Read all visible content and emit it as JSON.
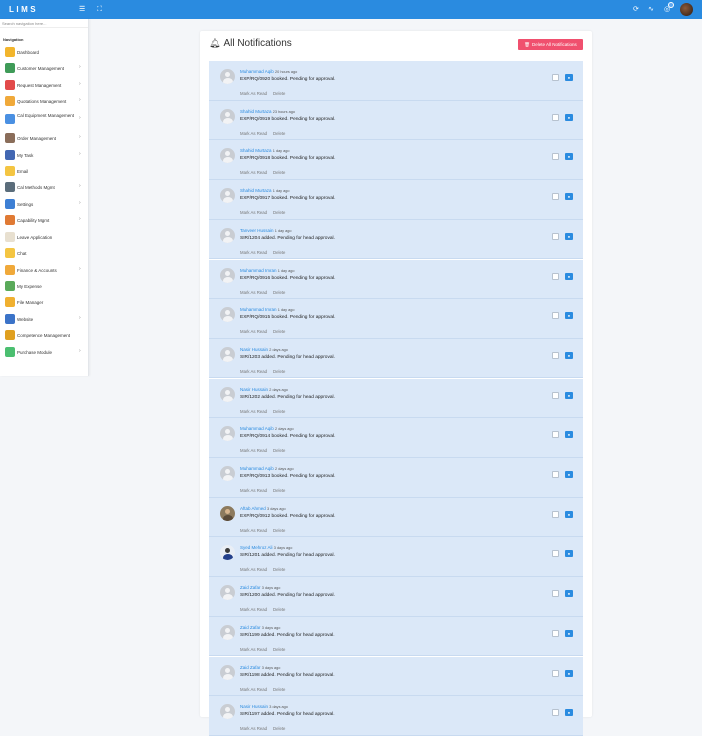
{
  "app": {
    "logo": "LIMS"
  },
  "search": {
    "placeholder": "Search navigation here..."
  },
  "nav_title": "Navigation",
  "nav": [
    {
      "label": "Dashboard",
      "arrow": false,
      "color": "#f2b52c"
    },
    {
      "label": "Customer Management",
      "arrow": true,
      "color": "#3f9b58"
    },
    {
      "label": "Request Management",
      "arrow": true,
      "color": "#e24a4a"
    },
    {
      "label": "Quotations Management",
      "arrow": true,
      "color": "#f0a93a"
    },
    {
      "label": "Cal Equipment Management",
      "arrow": true,
      "color": "#4a90e2"
    },
    {
      "label": "Order Management",
      "arrow": true,
      "color": "#8a6d5a"
    },
    {
      "label": "My Task",
      "arrow": true,
      "color": "#4267b2"
    },
    {
      "label": "Email",
      "arrow": false,
      "color": "#f4c542"
    },
    {
      "label": "Cal Methods Mgmt",
      "arrow": true,
      "color": "#5b6d7b"
    },
    {
      "label": "Settings",
      "arrow": true,
      "color": "#3d7fd4"
    },
    {
      "label": "Capability Mgmt",
      "arrow": true,
      "color": "#e07a34"
    },
    {
      "label": "Leave Application",
      "arrow": false,
      "color": "#e8e0d0"
    },
    {
      "label": "Chat",
      "arrow": false,
      "color": "#f4c542"
    },
    {
      "label": "Finance & Accounts",
      "arrow": true,
      "color": "#f0a93a"
    },
    {
      "label": "My Expense",
      "arrow": false,
      "color": "#5aaa5a"
    },
    {
      "label": "File Manager",
      "arrow": false,
      "color": "#f0b030"
    },
    {
      "label": "Website",
      "arrow": true,
      "color": "#3b73c8"
    },
    {
      "label": "Competence Management",
      "arrow": false,
      "color": "#e0a020"
    },
    {
      "label": "Purchase Module",
      "arrow": true,
      "color": "#4bbf70"
    }
  ],
  "page": {
    "title": "All Notifications",
    "delete_all": "Delete All Notifications"
  },
  "actions": {
    "mark": "Mark As Read",
    "delete": "Delete"
  },
  "notifications": [
    {
      "name": "Muhammad Aqib",
      "time": "20 hours ago",
      "msg": "EXP/RQ/0920 booked. Pending for approval.",
      "avatar": "default"
    },
    {
      "name": "Shahid Murtaza",
      "time": "23 hours ago",
      "msg": "EXP/RQ/0919 booked. Pending for approval.",
      "avatar": "default"
    },
    {
      "name": "Shahid Murtaza",
      "time": "1 day ago",
      "msg": "EXP/RQ/0918 booked. Pending for approval.",
      "avatar": "default"
    },
    {
      "name": "Shahid Murtaza",
      "time": "1 day ago",
      "msg": "EXP/RQ/0917 booked. Pending for approval.",
      "avatar": "default"
    },
    {
      "name": "Tanveer Hussain",
      "time": "1 day ago",
      "msg": "SIR/1204 added. Pending for head approval.",
      "avatar": "default"
    },
    {
      "name": "Muhammad Imran",
      "time": "1 day ago",
      "msg": "EXP/RQ/0916 booked. Pending for approval.",
      "avatar": "default"
    },
    {
      "name": "Muhammad Imran",
      "time": "1 day ago",
      "msg": "EXP/RQ/0915 booked. Pending for approval.",
      "avatar": "default"
    },
    {
      "name": "Nasir Hussain",
      "time": "2 days ago",
      "msg": "SIR/1203 added. Pending for head approval.",
      "avatar": "default"
    },
    {
      "name": "Nasir Hussain",
      "time": "2 days ago",
      "msg": "SIR/1202 added. Pending for head approval.",
      "avatar": "default"
    },
    {
      "name": "Muhammad Aqib",
      "time": "2 days ago",
      "msg": "EXP/RQ/0914 booked. Pending for approval.",
      "avatar": "default"
    },
    {
      "name": "Muhammad Aqib",
      "time": "2 days ago",
      "msg": "EXP/RQ/0913 booked. Pending for approval.",
      "avatar": "default"
    },
    {
      "name": "Aftab Ahmed",
      "time": "3 days ago",
      "msg": "EXP/RQ/0912 booked. Pending for approval.",
      "avatar": "photo"
    },
    {
      "name": "Syed Mehroz Ali",
      "time": "3 days ago",
      "msg": "SIR/1201 added. Pending for head approval.",
      "avatar": "photo2"
    },
    {
      "name": "Zaid Zafar",
      "time": "3 days ago",
      "msg": "SIR/1200 added. Pending for head approval.",
      "avatar": "default"
    },
    {
      "name": "Zaid Zafar",
      "time": "3 days ago",
      "msg": "SIR/1199 added. Pending for head approval.",
      "avatar": "default"
    },
    {
      "name": "Zaid Zafar",
      "time": "3 days ago",
      "msg": "SIR/1198 added. Pending for head approval.",
      "avatar": "default"
    },
    {
      "name": "Nasir Hussain",
      "time": "3 days ago",
      "msg": "SIR/1197 added. Pending for head approval.",
      "avatar": "default"
    }
  ]
}
